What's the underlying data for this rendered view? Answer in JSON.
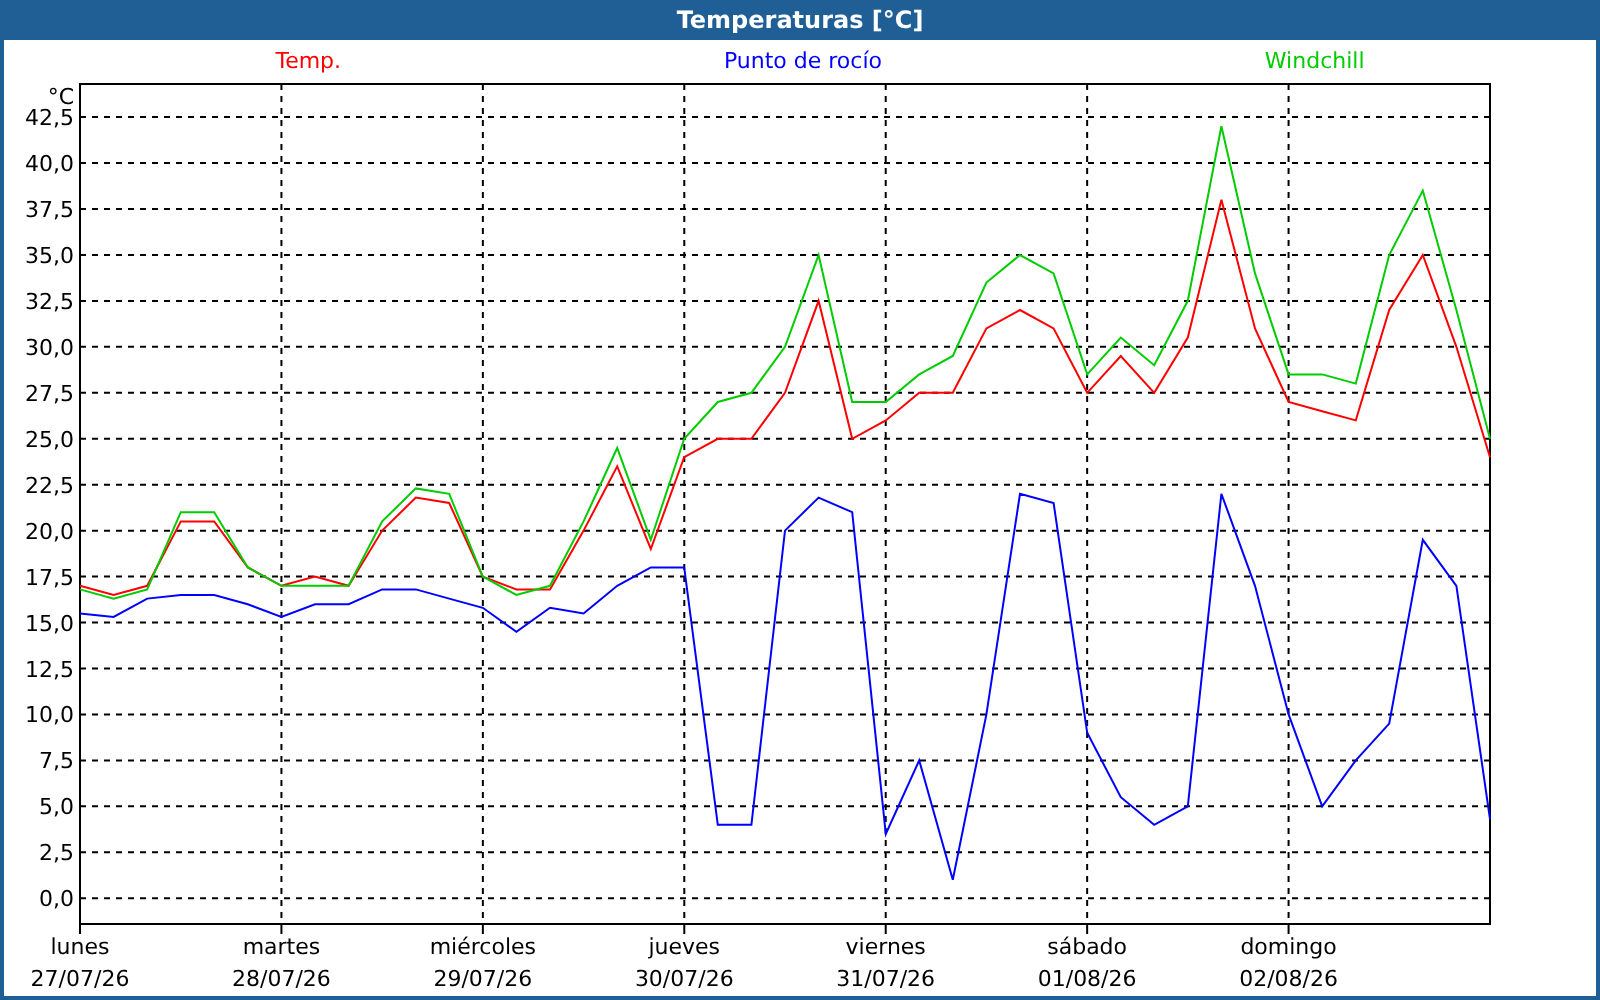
{
  "window": {
    "title": "Temperaturas [°C]"
  },
  "chart": {
    "chart_data": {
      "type": "line",
      "grid": true,
      "ylabel": "°C",
      "categories": [
        "lunes 27/07/26",
        null,
        null,
        null,
        null,
        null,
        "martes 28/07/26",
        null,
        null,
        null,
        null,
        null,
        "miércoles 29/07/26",
        null,
        null,
        null,
        null,
        null,
        "jueves 30/07/26",
        null,
        null,
        null,
        null,
        null,
        "viernes 31/07/26",
        null,
        null,
        null,
        null,
        null,
        "sábado 01/08/26",
        null,
        null,
        null,
        null,
        null,
        "domingo 02/08/26",
        null,
        null,
        null,
        null,
        null,
        null
      ],
      "ylim": [
        -1.4,
        44.3
      ],
      "yticks": [
        {
          "value": 0,
          "label": "0,0"
        },
        {
          "value": 2.5,
          "label": "2,5"
        },
        {
          "value": 5,
          "label": "5,0"
        },
        {
          "value": 7.5,
          "label": "7,5"
        },
        {
          "value": 10,
          "label": "10,0"
        },
        {
          "value": 12.5,
          "label": "12,5"
        },
        {
          "value": 15,
          "label": "15,0"
        },
        {
          "value": 17.5,
          "label": "17,5"
        },
        {
          "value": 20,
          "label": "20,0"
        },
        {
          "value": 22.5,
          "label": "22,5"
        },
        {
          "value": 25,
          "label": "25,0"
        },
        {
          "value": 27.5,
          "label": "27,5"
        },
        {
          "value": 30,
          "label": "30,0"
        },
        {
          "value": 32.5,
          "label": "32,5"
        },
        {
          "value": 35,
          "label": "35,0"
        },
        {
          "value": 37.5,
          "label": "37,5"
        },
        {
          "value": 40,
          "label": "40,0"
        },
        {
          "value": 42.5,
          "label": "42,5"
        }
      ],
      "series": [
        {
          "name": "Temp.",
          "color": "#ff0000",
          "values": [
            17,
            16.5,
            17,
            20.5,
            20.5,
            18,
            17,
            17.5,
            17,
            20,
            21.8,
            21.5,
            17.5,
            16.8,
            16.8,
            20,
            23.5,
            19,
            24,
            25,
            25,
            27.5,
            32.5,
            25,
            26,
            27.5,
            27.5,
            31,
            32,
            31,
            27.5,
            29.5,
            27.5,
            30.5,
            38,
            31,
            27,
            26.5,
            26,
            32,
            35,
            30,
            24
          ]
        },
        {
          "name": "Punto de rocío",
          "color": "#0000ff",
          "values": [
            15.5,
            15.3,
            16.3,
            16.5,
            16.5,
            16,
            15.3,
            16,
            16,
            16.8,
            16.8,
            16.3,
            15.8,
            14.5,
            15.8,
            15.5,
            17,
            18,
            18,
            4,
            4,
            20,
            21.8,
            21,
            3.5,
            7.5,
            1,
            10,
            22,
            21.5,
            9,
            5.5,
            4,
            5,
            22,
            17,
            10,
            5,
            7.5,
            9.5,
            19.5,
            17,
            4.3
          ]
        },
        {
          "name": "Windchill",
          "color": "#00cc00",
          "values": [
            16.8,
            16.3,
            16.8,
            21,
            21,
            18,
            17,
            17,
            17,
            20.5,
            22.3,
            22,
            17.5,
            16.5,
            17,
            20.5,
            24.5,
            19.5,
            25,
            27,
            27.5,
            30,
            35,
            27,
            27,
            28.5,
            29.5,
            33.5,
            35,
            34,
            28.5,
            30.5,
            29,
            32.5,
            42,
            34,
            28.5,
            28.5,
            28,
            35,
            38.5,
            32,
            25
          ]
        }
      ]
    }
  }
}
